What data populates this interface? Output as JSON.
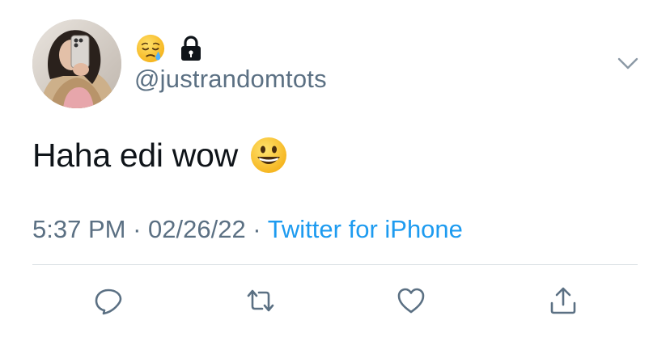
{
  "tweet": {
    "author": {
      "handle": "@justrandomtots",
      "name_icons": [
        "sleepy-face-emoji",
        "lock-icon"
      ]
    },
    "text": "Haha edi wow",
    "text_emoji": "grinning-face-emoji",
    "meta": {
      "time": "5:37 PM",
      "separator": " · ",
      "date": "02/26/22",
      "separator2": " · ",
      "source": "Twitter for iPhone"
    }
  },
  "actions": [
    "reply-icon",
    "retweet-icon",
    "like-icon",
    "share-icon"
  ],
  "colors": {
    "text": "#0f1419",
    "secondary": "#5b7083",
    "link": "#1d9bf0",
    "divider": "#d9dfe3"
  }
}
